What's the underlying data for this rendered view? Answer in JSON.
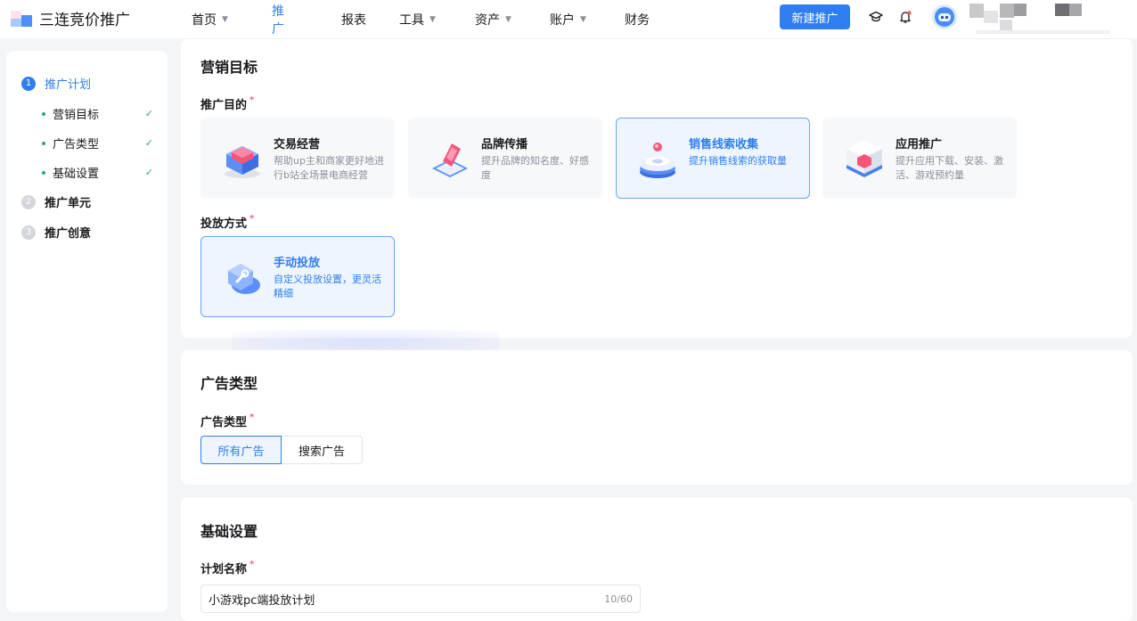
{
  "brand": {
    "name": "三连竞价推广"
  },
  "nav": [
    {
      "label": "首页",
      "caret": "▼"
    },
    {
      "label": "推广",
      "caret": ""
    },
    {
      "label": "报表",
      "caret": ""
    },
    {
      "label": "工具",
      "caret": "▼"
    },
    {
      "label": "资产",
      "caret": "▼"
    },
    {
      "label": "账户",
      "caret": "▼"
    },
    {
      "label": "财务",
      "caret": ""
    }
  ],
  "header": {
    "new_button": "新建推广"
  },
  "steps": {
    "items": [
      {
        "num": "1",
        "label": "推广计划"
      },
      {
        "num": "2",
        "label": "推广单元"
      },
      {
        "num": "3",
        "label": "推广创意"
      }
    ],
    "subs": [
      {
        "label": "营销目标",
        "check": "✓"
      },
      {
        "label": "广告类型",
        "check": "✓"
      },
      {
        "label": "基础设置",
        "check": "✓"
      }
    ]
  },
  "marketing": {
    "title": "营销目标",
    "purpose_label": "推广目的",
    "required_mark": "*",
    "purposes": [
      {
        "title": "交易经营",
        "desc": "帮助up主和商家更好地进行b站全场景电商经营"
      },
      {
        "title": "品牌传播",
        "desc": "提升品牌的知名度、好感度"
      },
      {
        "title": "销售线索收集",
        "desc": "提升销售线索的获取量"
      },
      {
        "title": "应用推广",
        "desc": "提升应用下载、安装、激活、游戏预约量"
      }
    ],
    "method_label": "投放方式",
    "method": {
      "title": "手动投放",
      "desc": "自定义投放设置，更灵活精细"
    }
  },
  "ad_type": {
    "title": "广告类型",
    "label": "广告类型",
    "options": [
      "所有广告",
      "搜索广告"
    ]
  },
  "basic": {
    "title": "基础设置",
    "name_label": "计划名称",
    "name_value": "小游戏pc端投放计划",
    "name_count": "10/60"
  },
  "colors": {
    "accent": "#2f7ef0",
    "success": "#26a86f",
    "required": "#f25d8e"
  }
}
